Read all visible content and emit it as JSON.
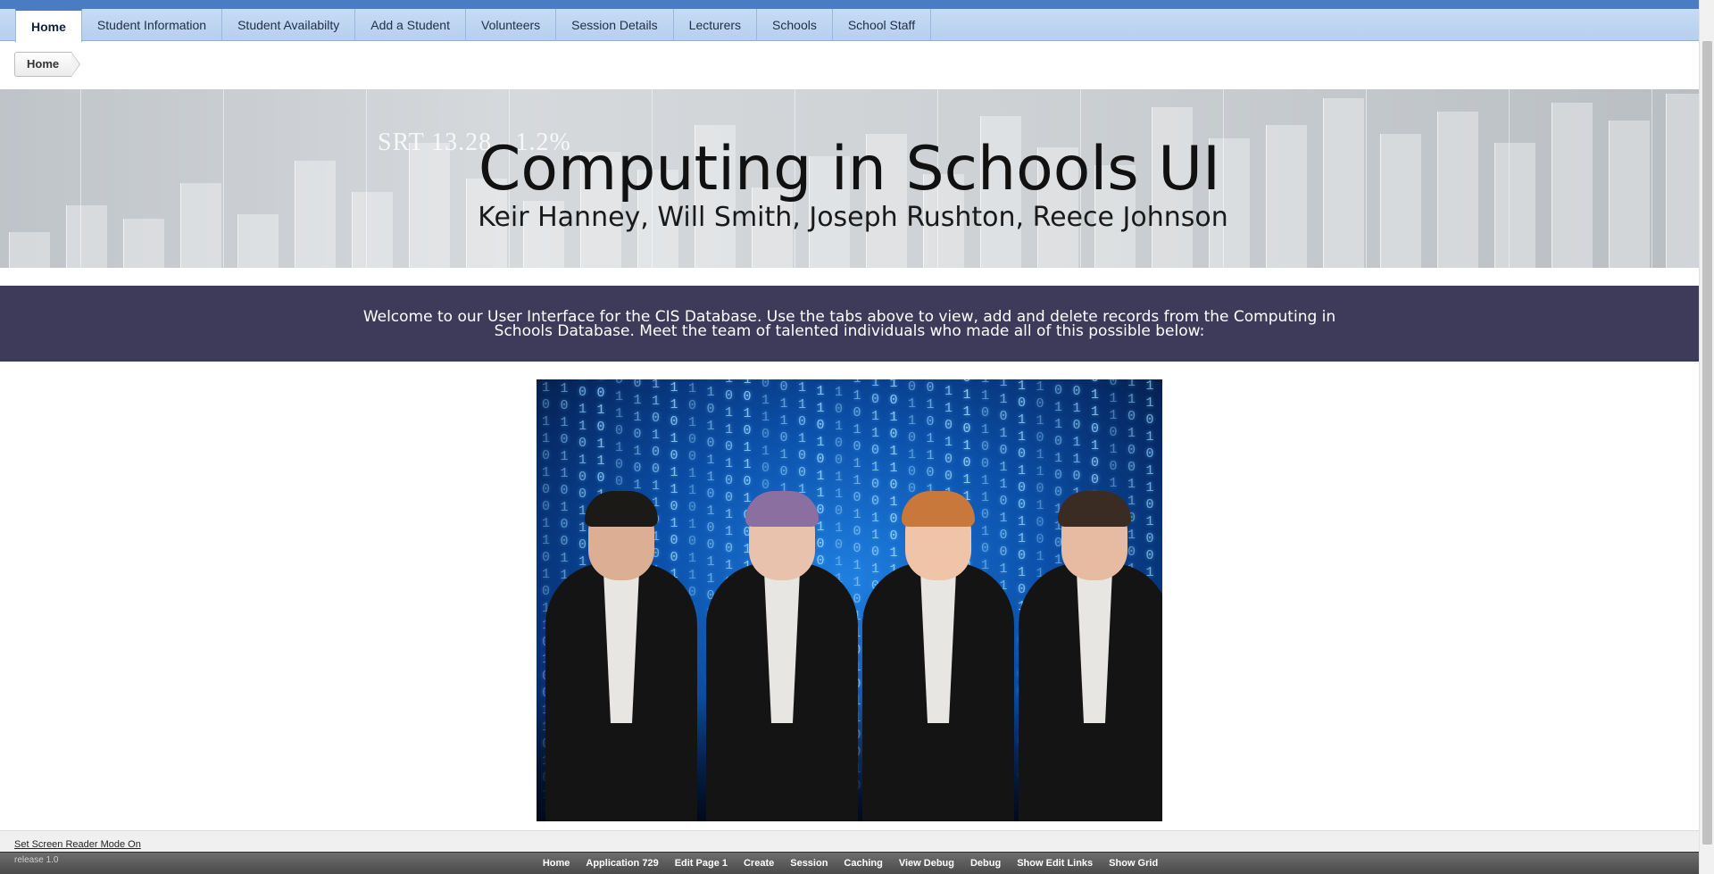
{
  "nav": {
    "tabs": [
      {
        "label": "Home",
        "active": true
      },
      {
        "label": "Student Information"
      },
      {
        "label": "Student Availabilty"
      },
      {
        "label": "Add a Student"
      },
      {
        "label": "Volunteers"
      },
      {
        "label": "Session Details"
      },
      {
        "label": "Lecturers"
      },
      {
        "label": "Schools"
      },
      {
        "label": "School Staff"
      }
    ]
  },
  "breadcrumb": {
    "current": "Home"
  },
  "hero": {
    "ticker": "SRT 13.28 - 1.2%",
    "title": "Computing in Schools UI",
    "subtitle": "Keir Hanney, Will Smith, Joseph Rushton, Reece Johnson"
  },
  "welcome": {
    "text": "Welcome to our User Interface for the CIS Database. Use the tabs above to view, add and delete records from the Computing in Schools Database. Meet the team of talented individuals who made all of this possible below:"
  },
  "team_photo": {
    "icon": "team-photo-image"
  },
  "footer": {
    "screen_reader_link": "Set Screen Reader Mode On",
    "release": "release 1.0",
    "dev_links": [
      "Home",
      "Application 729",
      "Edit Page 1",
      "Create",
      "Session",
      "Caching",
      "View Debug",
      "Debug",
      "Show Edit Links",
      "Show Grid"
    ]
  },
  "colors": {
    "tab_bar": "#b6cfee",
    "top_strip": "#4a7cc4",
    "welcome_band": "#3d3a5a",
    "devbar": "#4a4a4a"
  }
}
